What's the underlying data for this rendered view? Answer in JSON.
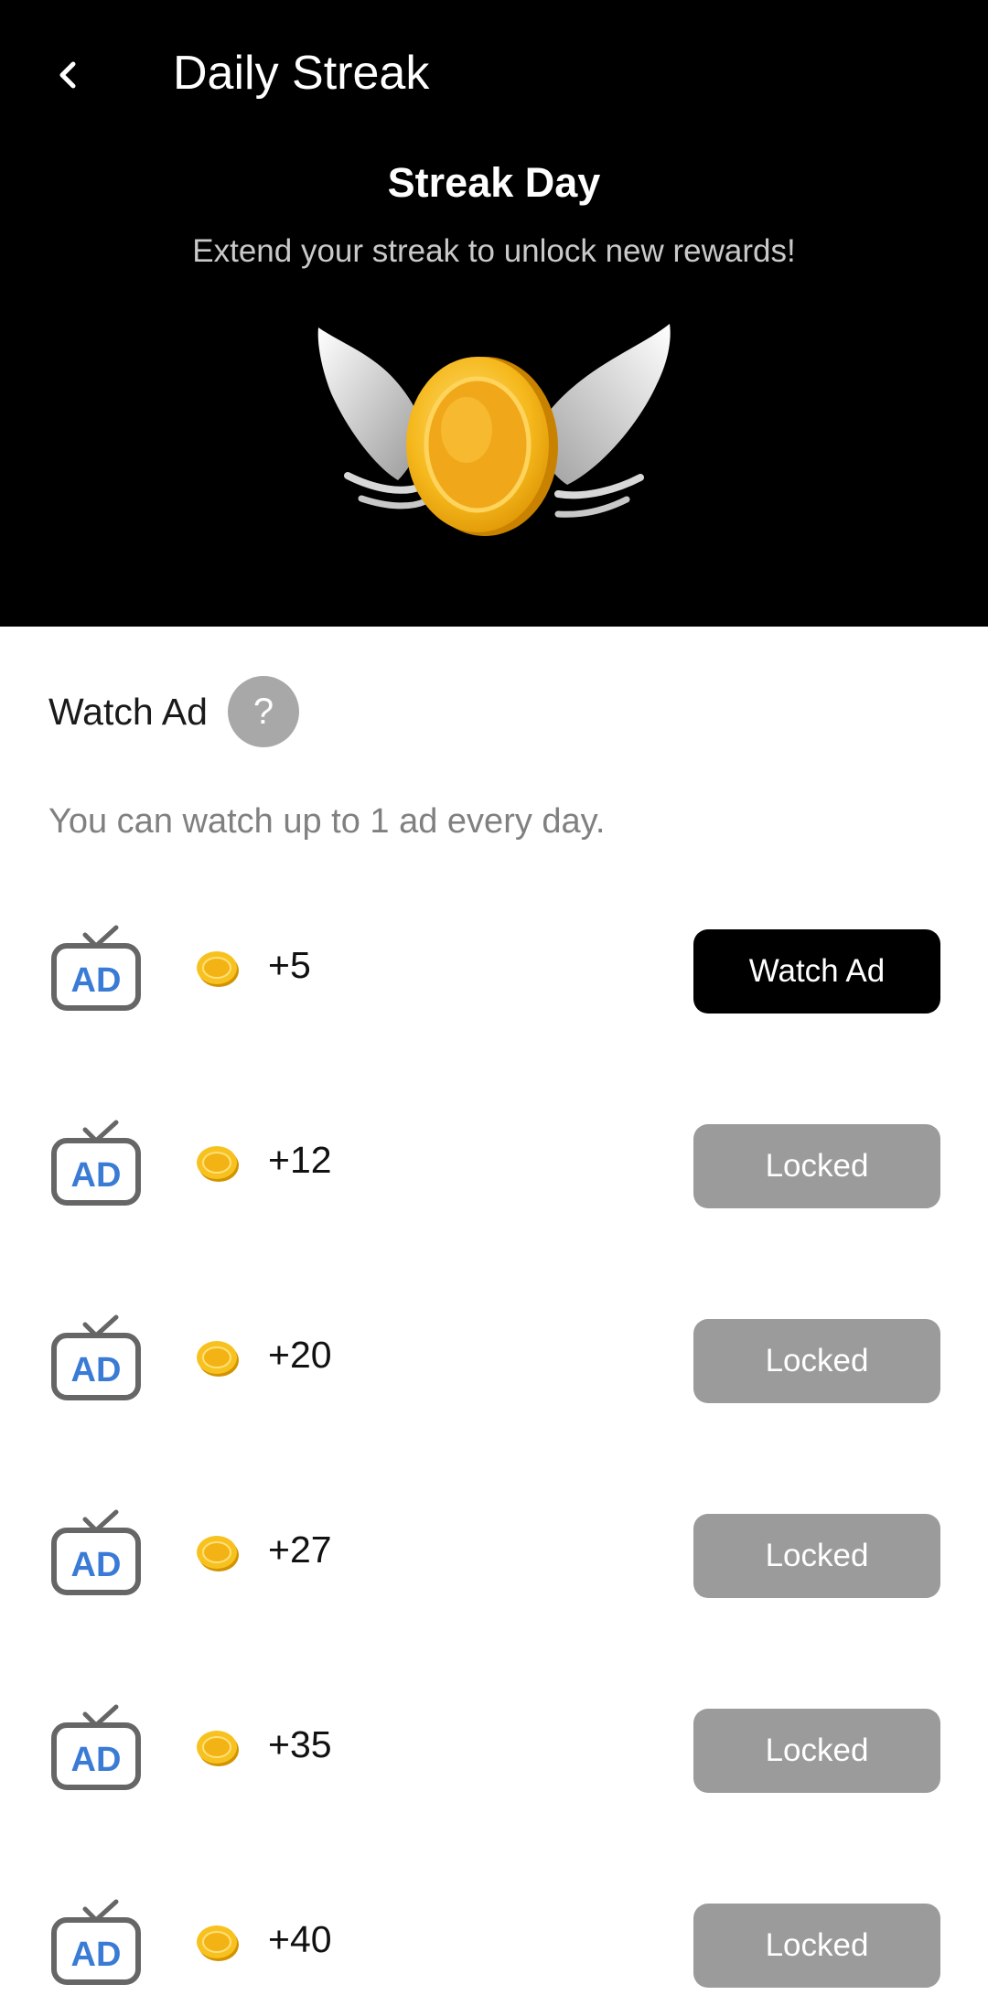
{
  "header": {
    "title": "Daily Streak",
    "back_icon": "chevron-left-icon"
  },
  "hero": {
    "title": "Streak Day",
    "subtitle": "Extend your streak to unlock new rewards!",
    "image": "winged-coin-image"
  },
  "watch_ad": {
    "title": "Watch Ad",
    "help_label": "?",
    "limit_text": "You can watch up to 1 ad every day."
  },
  "colors": {
    "hero_bg": "#000000",
    "active_button": "#000000",
    "locked_button": "#9b9b9b",
    "ad_icon_accent": "#3a7bd5",
    "coin": "#f5c518"
  },
  "rewards": [
    {
      "amount": "+5",
      "button": "Watch Ad",
      "state": "active"
    },
    {
      "amount": "+12",
      "button": "Locked",
      "state": "locked"
    },
    {
      "amount": "+20",
      "button": "Locked",
      "state": "locked"
    },
    {
      "amount": "+27",
      "button": "Locked",
      "state": "locked"
    },
    {
      "amount": "+35",
      "button": "Locked",
      "state": "locked"
    },
    {
      "amount": "+40",
      "button": "Locked",
      "state": "locked"
    }
  ]
}
